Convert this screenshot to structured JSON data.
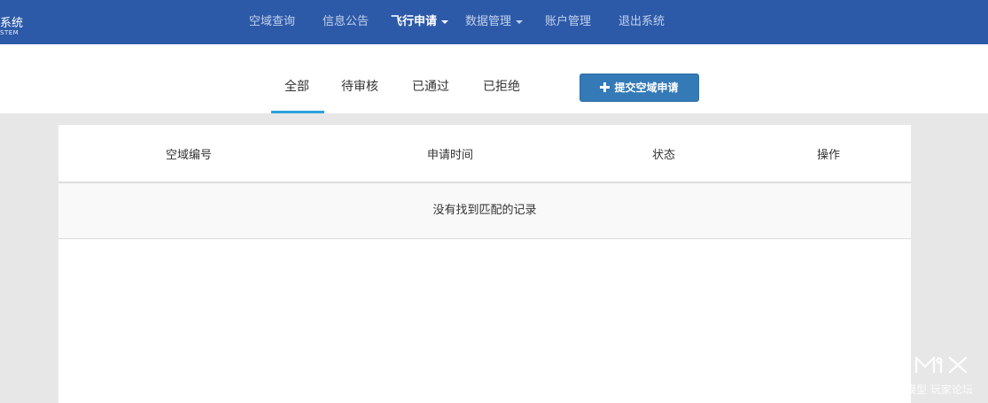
{
  "header": {
    "logo_title": "系统",
    "logo_subtitle": "STEM",
    "nav": [
      {
        "label": "空域查询",
        "active": false,
        "dropdown": false
      },
      {
        "label": "信息公告",
        "active": false,
        "dropdown": false
      },
      {
        "label": "飞行申请",
        "active": true,
        "dropdown": true
      },
      {
        "label": "数据管理",
        "active": false,
        "dropdown": true
      },
      {
        "label": "账户管理",
        "active": false,
        "dropdown": false
      },
      {
        "label": "退出系统",
        "active": false,
        "dropdown": false
      }
    ]
  },
  "tabs": [
    {
      "label": "全部",
      "active": true
    },
    {
      "label": "待审核",
      "active": false
    },
    {
      "label": "已通过",
      "active": false
    },
    {
      "label": "已拒绝",
      "active": false
    }
  ],
  "submit_button": {
    "label": "提交空域申请",
    "icon": "plus-icon"
  },
  "table": {
    "columns": [
      "空域编号",
      "申请时间",
      "状态",
      "操作"
    ],
    "empty_message": "没有找到匹配的记录"
  },
  "watermark": {
    "text": "SIMX 我爱模型 玩家论坛"
  },
  "colors": {
    "header_bg": "#2d5aa8",
    "button_bg": "#337ab7",
    "tab_underline": "#2aa2dd",
    "page_bg": "#e7e7e7"
  }
}
